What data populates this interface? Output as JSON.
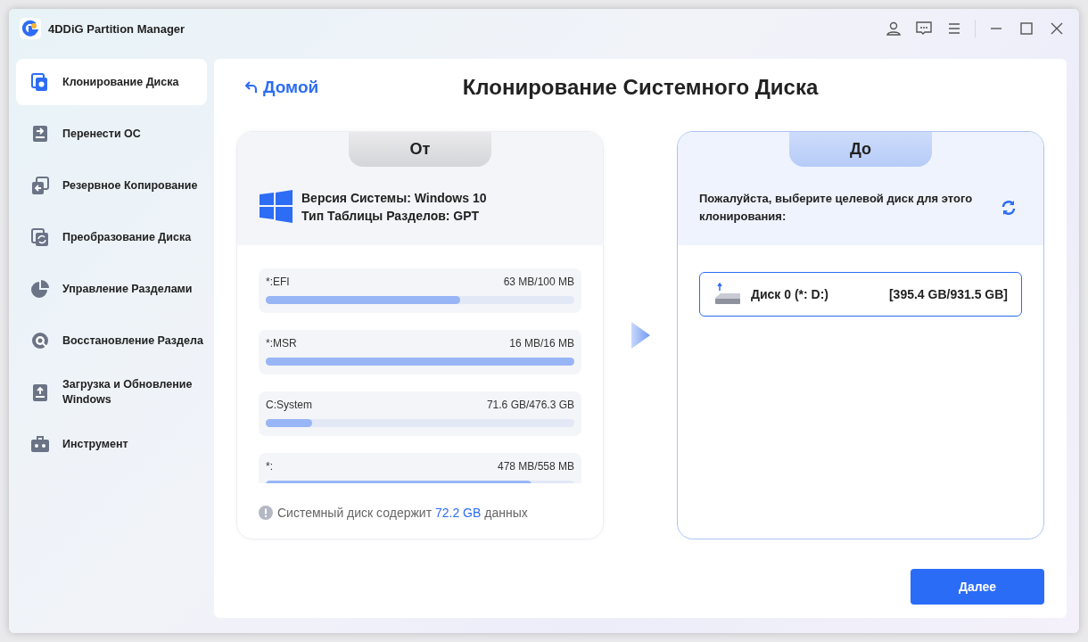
{
  "window": {
    "title": "4DDiG Partition Manager"
  },
  "sidebar": {
    "items": [
      {
        "label": "Клонирование Диска",
        "kind": "clone",
        "selected": true
      },
      {
        "label": "Перенести ОС",
        "kind": "migrate",
        "selected": false
      },
      {
        "label": "Резервное Копирование",
        "kind": "backup",
        "selected": false
      },
      {
        "label": "Преобразование Диска",
        "kind": "convert",
        "selected": false
      },
      {
        "label": "Управление Разделами",
        "kind": "pie",
        "selected": false
      },
      {
        "label": "Восстановление Раздела",
        "kind": "recover",
        "selected": false
      },
      {
        "label": "Загрузка и Обновление Windows",
        "kind": "boot",
        "selected": false
      },
      {
        "label": "Инструмент",
        "kind": "toolbox",
        "selected": false
      }
    ]
  },
  "back_link": "Домой",
  "title": "Клонирование Системного Диска",
  "source": {
    "tab": "От",
    "system_version": "Версия Системы: Windows 10",
    "partition_table": "Тип Таблицы Разделов: GPT",
    "partitions": [
      {
        "name": "*:EFI",
        "usage": "63 MB/100 MB",
        "level": 0.63
      },
      {
        "name": "*:MSR",
        "usage": "16 MB/16 MB",
        "level": 1.0
      },
      {
        "name": "C:System",
        "usage": "71.6 GB/476.3 GB",
        "level": 0.15
      },
      {
        "name": "*:",
        "usage": "478 MB/558 MB",
        "level": 0.86
      }
    ],
    "note": "Системный диск содержит **72.2 GB** данных"
  },
  "target": {
    "tab": "До",
    "prompt": "Пожалуйста, выберите целевой диск для этого клонирования:",
    "disks": [
      {
        "name": "Диск 0 (*: D:)",
        "size": "[395.4 GB/931.5 GB]",
        "selected": true
      }
    ]
  },
  "next_button": "Далее"
}
